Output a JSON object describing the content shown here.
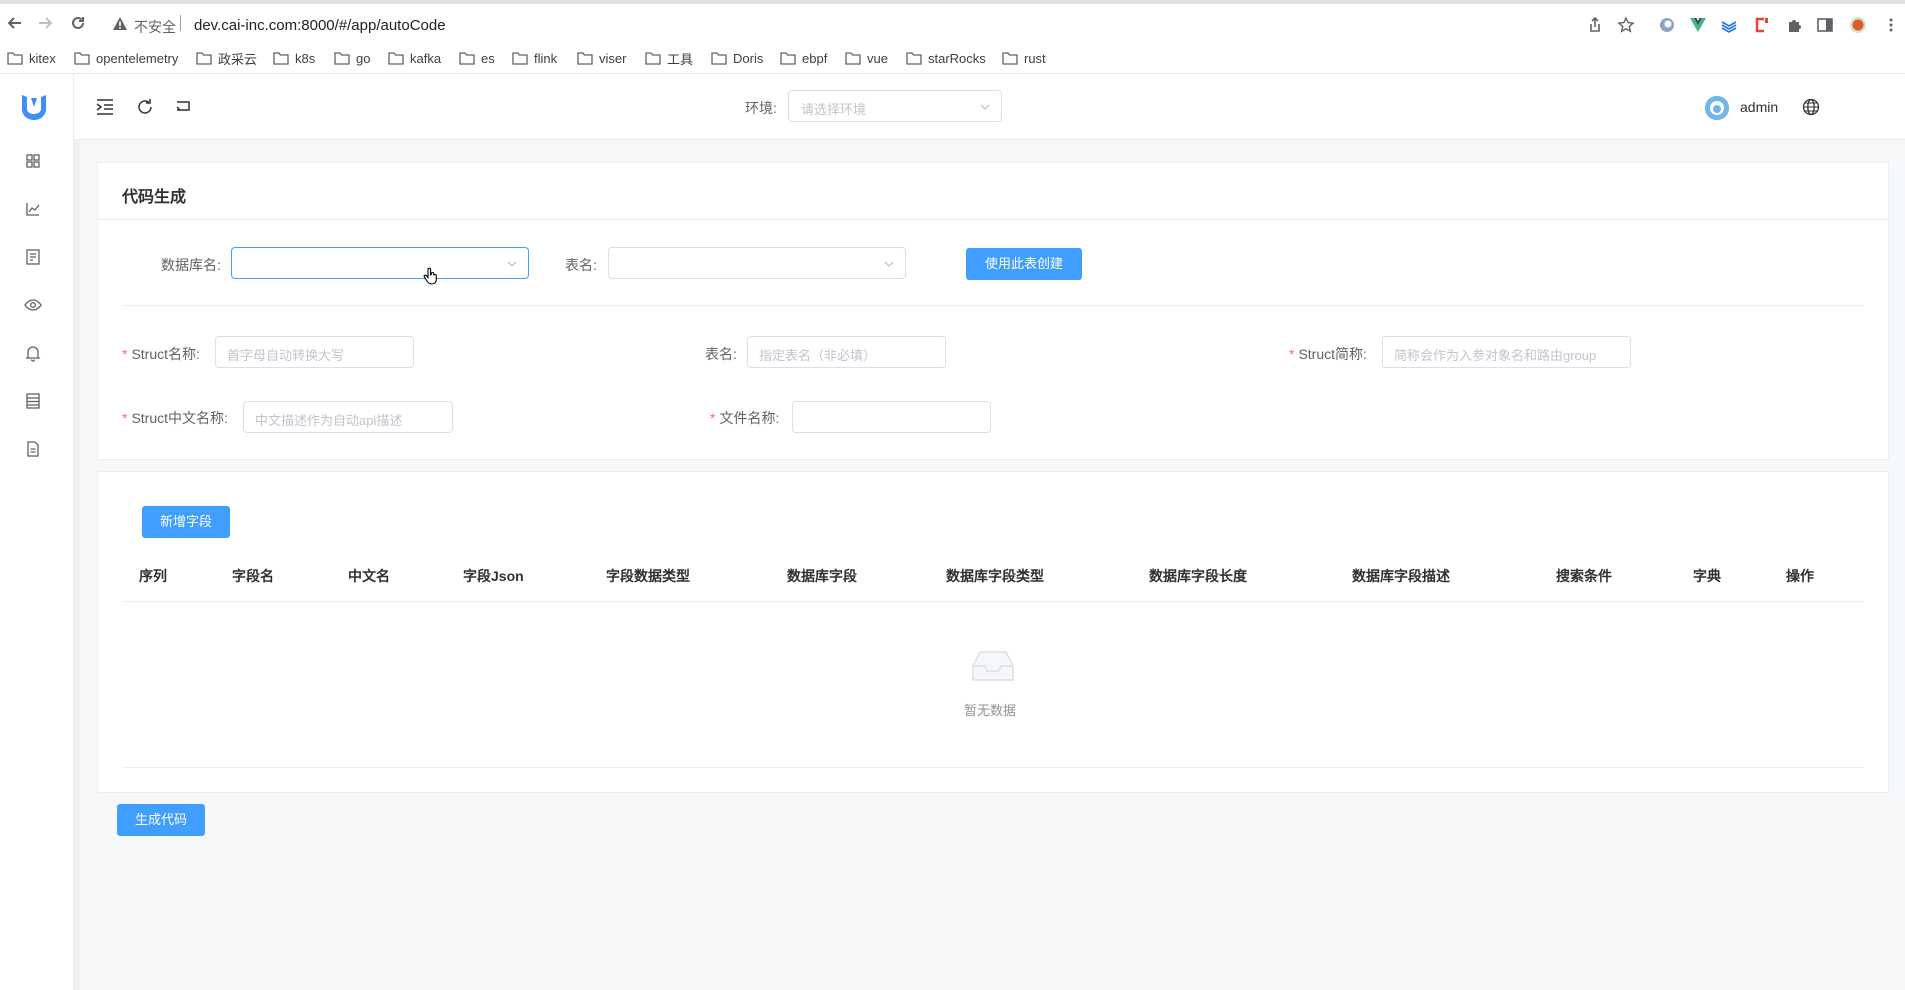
{
  "browser": {
    "insecure_label": "不安全",
    "url": "dev.cai-inc.com:8000/#/app/autoCode",
    "bookmarks": [
      "kitex",
      "opentelemetry",
      "政采云",
      "k8s",
      "go",
      "kafka",
      "es",
      "flink",
      "viser",
      "工具",
      "Doris",
      "ebpf",
      "vue",
      "starRocks",
      "rust"
    ]
  },
  "header": {
    "env_label": "环境:",
    "env_placeholder": "请选择环境",
    "username": "admin"
  },
  "sidebar": {
    "icons": [
      "dashboard-icon",
      "chart-icon",
      "list-icon",
      "eye-icon",
      "bell-icon",
      "table-icon",
      "document-icon"
    ]
  },
  "form_card": {
    "title": "代码生成",
    "db_label": "数据库名:",
    "table_label": "表名:",
    "create_button": "使用此表创建",
    "struct_name_label": "Struct名称:",
    "struct_name_placeholder": "首字母自动转换大写",
    "table_name_label": "表名:",
    "table_name_placeholder": "指定表名（非必填）",
    "struct_abbr_label": "Struct简称:",
    "struct_abbr_placeholder": "简称会作为入参对象名和路由group",
    "struct_cn_label": "Struct中文名称:",
    "struct_cn_placeholder": "中文描述作为自动api描述",
    "file_name_label": "文件名称:",
    "required_mark": "*"
  },
  "fields_card": {
    "add_button": "新增字段",
    "columns": [
      "序列",
      "字段名",
      "中文名",
      "字段Json",
      "字段数据类型",
      "数据库字段",
      "数据库字段类型",
      "数据库字段长度",
      "数据库字段描述",
      "搜索条件",
      "字典",
      "操作"
    ],
    "empty_text": "暂无数据"
  },
  "footer": {
    "generate_button": "生成代码"
  },
  "colors": {
    "primary": "#409eff",
    "required": "#f56c6c",
    "logo": "#3d8ef7"
  }
}
